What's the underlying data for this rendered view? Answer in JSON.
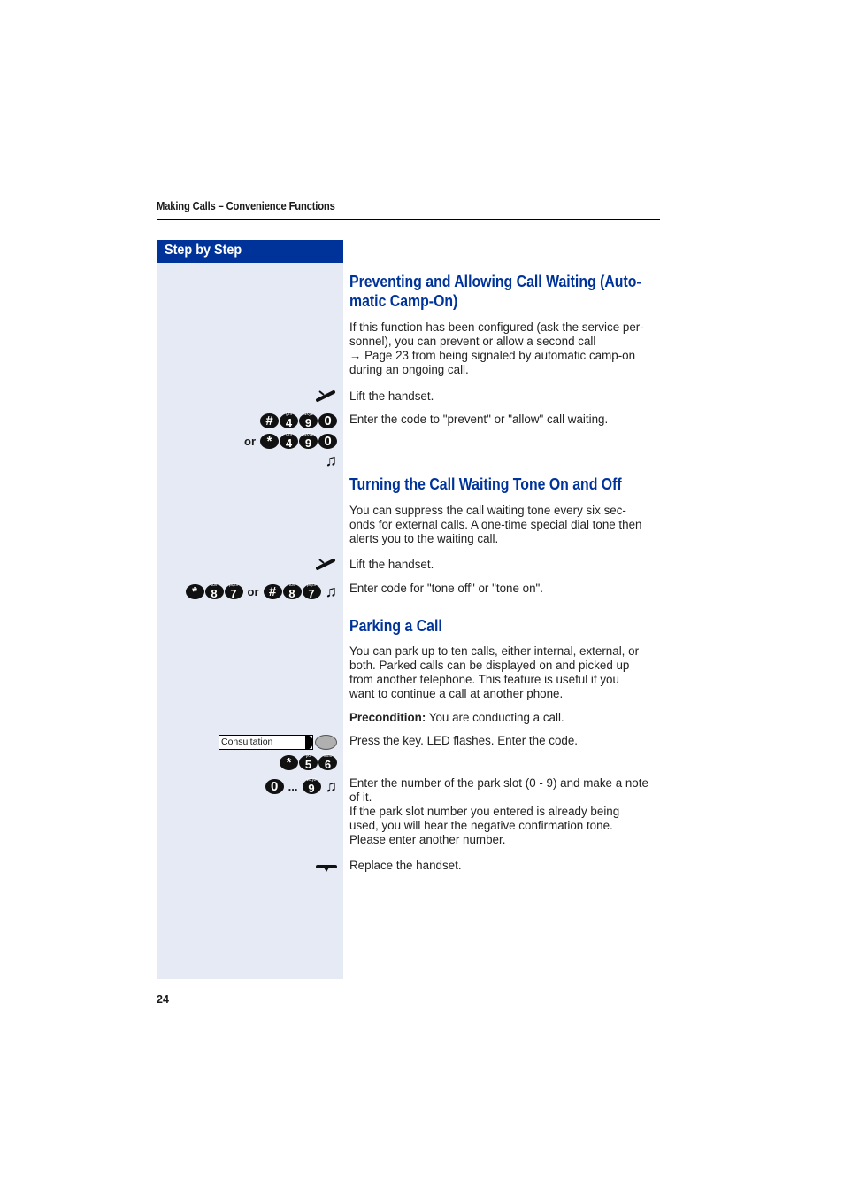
{
  "header": {
    "running_head": "Making Calls – Convenience Functions"
  },
  "sidebar": {
    "title": "Step by Step"
  },
  "sections": [
    {
      "title_line1": "Preventing and Allowing Call Waiting (Auto-",
      "title_line2": "matic Camp-On)",
      "intro": [
        "If this function has been configured (ask the service per-",
        "sonnel), you can prevent or allow a second call",
        "→ Page 23 from being signaled by automatic camp-on",
        "during an ongoing call."
      ],
      "steps": [
        {
          "icon": "lift-handset-icon",
          "text": "Lift the handset."
        },
        {
          "keys_a": [
            "#",
            "4",
            "9",
            "0"
          ],
          "keys_b": [
            "*",
            "4",
            "9",
            "0"
          ],
          "or": "or",
          "text": "Enter the code to \"prevent\" or \"allow\" call waiting."
        }
      ]
    },
    {
      "title": "Turning the Call Waiting Tone On and Off",
      "intro": [
        "You can suppress the call waiting tone every six sec-",
        "onds for external calls. A one-time special dial tone then",
        "alerts you to the waiting call."
      ],
      "steps": [
        {
          "icon": "lift-handset-icon",
          "text": "Lift the handset."
        },
        {
          "keys_a": [
            "*",
            "8",
            "7"
          ],
          "keys_b": [
            "#",
            "8",
            "7"
          ],
          "or": "or",
          "text": "Enter code for \"tone off\" or \"tone on\"."
        }
      ]
    },
    {
      "title": "Parking a Call",
      "intro": [
        "You can park up to ten calls, either internal, external, or",
        "both. Parked calls can be displayed on and picked up",
        "from another telephone. This feature is useful if you",
        "want to continue a call at another phone."
      ],
      "precondition_label": "Precondition:",
      "precondition_text": " You are conducting a call.",
      "steps": [
        {
          "key_label": "Consultation",
          "text": "Press the key. LED flashes. Enter the code."
        },
        {
          "keys": [
            "*",
            "5",
            "6"
          ]
        },
        {
          "keys": [
            "0",
            "9"
          ],
          "ellipsis": "...",
          "text": [
            "Enter the number of the park slot (0 - 9) and make a note",
            "of it.",
            "If the park slot number you entered is already being",
            "used, you will hear the negative confirmation tone.",
            "Please enter another number."
          ]
        },
        {
          "icon": "replace-handset-icon",
          "text": "Replace the handset."
        }
      ]
    }
  ],
  "key_sublabels": {
    "4": "ghi",
    "5": "jkl",
    "6": "mno",
    "7": "pqrs",
    "8": "tuv",
    "9": "wxyz"
  },
  "footer": {
    "page_number": "24"
  },
  "colors": {
    "accent": "#003399",
    "sidebar_bg": "#e5eaf5"
  }
}
